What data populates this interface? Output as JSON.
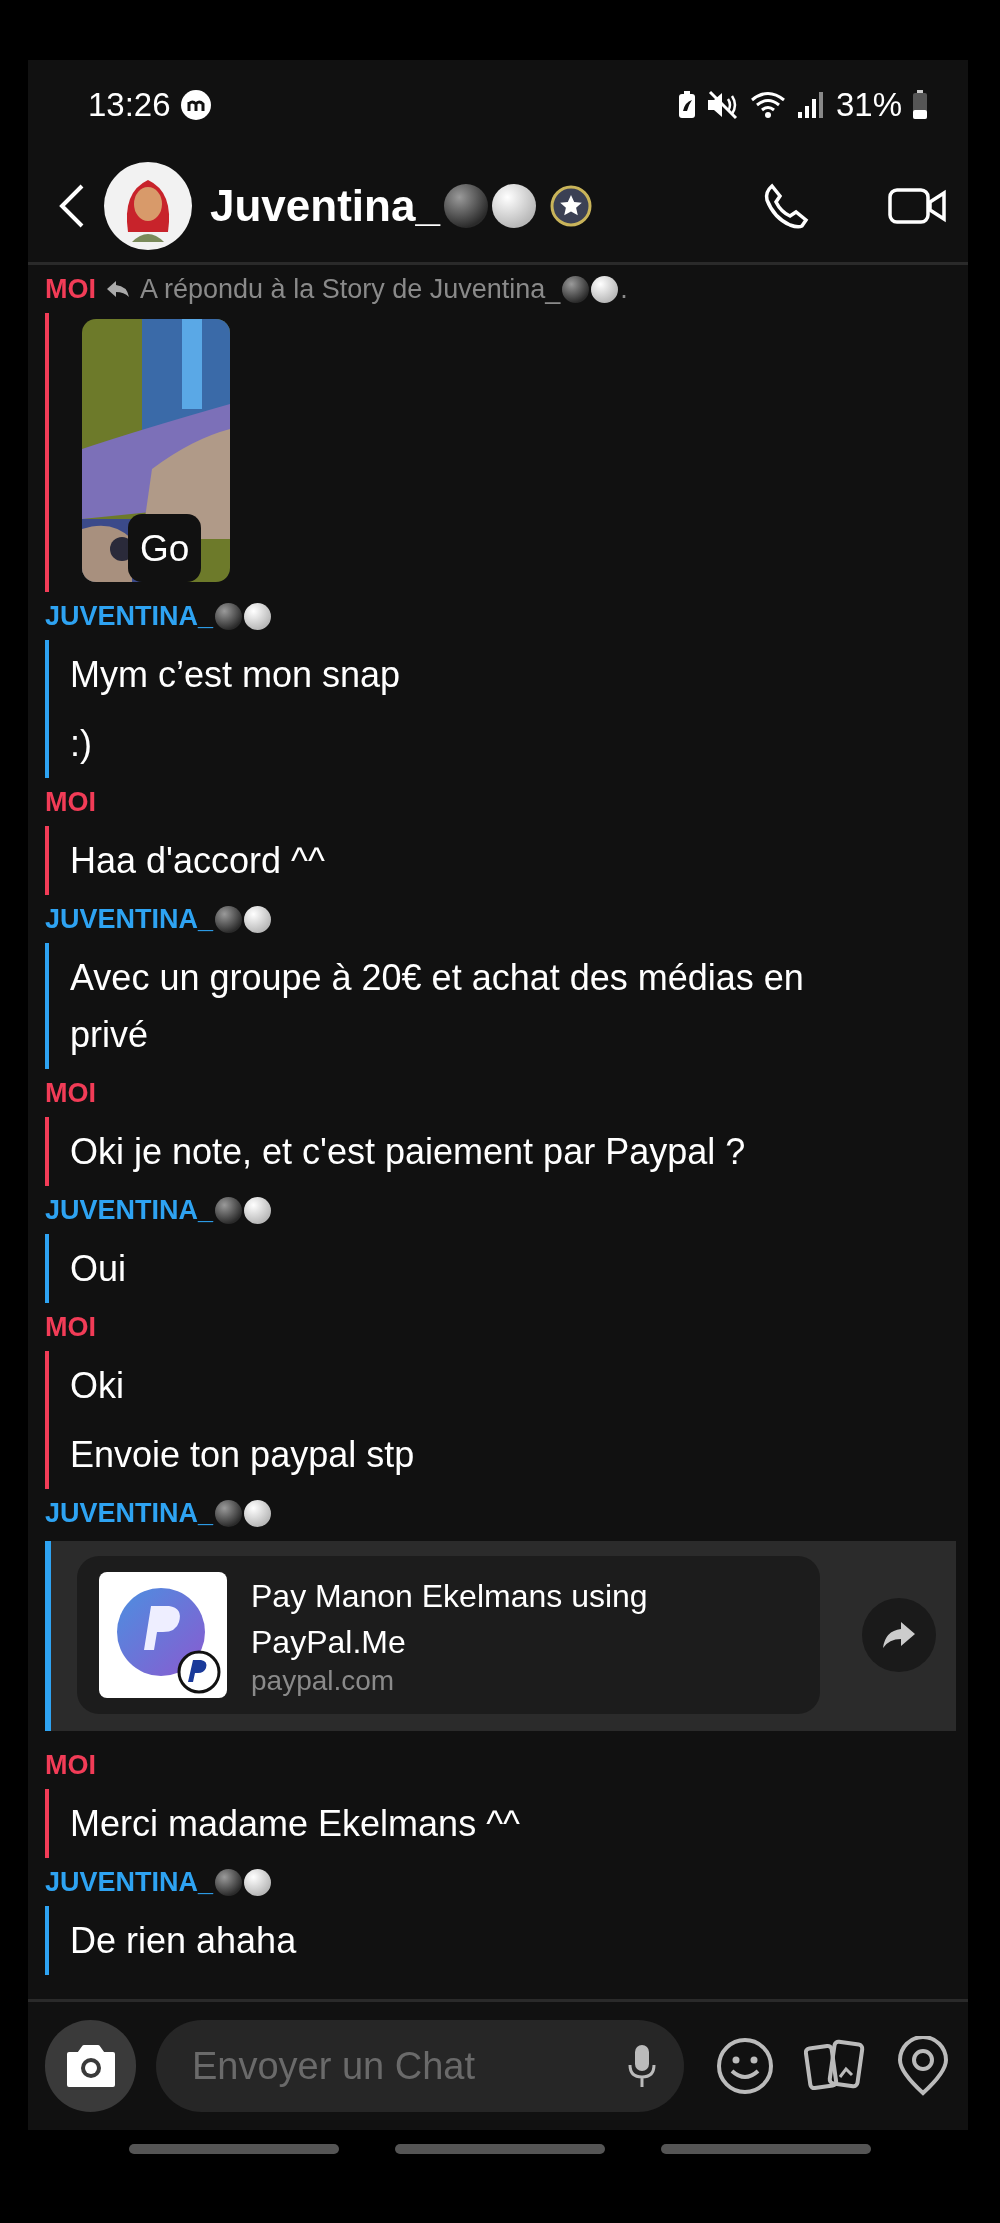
{
  "status_bar": {
    "time": "13:26",
    "battery": "31%"
  },
  "header": {
    "name": "Juventina_"
  },
  "groups": [
    {
      "sender": "MOI",
      "kind": "me",
      "reply_note": "A répondu à la Story de Juventina_",
      "reply_note_end": ".",
      "messages": [
        {
          "kind": "story",
          "text": "Go"
        }
      ]
    },
    {
      "sender": "JUVENTINA_",
      "kind": "them",
      "messages": [
        {
          "kind": "text",
          "text": "Mym c’est mon snap"
        },
        {
          "kind": "text",
          "text": ":)"
        }
      ]
    },
    {
      "sender": "MOI",
      "kind": "me",
      "messages": [
        {
          "kind": "text",
          "text": "Haa d'accord ^^"
        }
      ]
    },
    {
      "sender": "JUVENTINA_",
      "kind": "them",
      "messages": [
        {
          "kind": "text",
          "text": "Avec un groupe à 20€ et achat des médias en privé"
        }
      ]
    },
    {
      "sender": "MOI",
      "kind": "me",
      "messages": [
        {
          "kind": "text",
          "text": "Oki je note, et c'est paiement par Paypal ?"
        }
      ]
    },
    {
      "sender": "JUVENTINA_",
      "kind": "them",
      "messages": [
        {
          "kind": "text",
          "text": "Oui"
        }
      ]
    },
    {
      "sender": "MOI",
      "kind": "me",
      "messages": [
        {
          "kind": "text",
          "text": "Oki"
        },
        {
          "kind": "text",
          "text": "Envoie ton paypal stp"
        }
      ]
    },
    {
      "sender": "JUVENTINA_",
      "kind": "them",
      "messages": [
        {
          "kind": "link",
          "title": "Pay Manon Ekelmans using PayPal.Me",
          "domain": "paypal.com"
        }
      ]
    },
    {
      "sender": "MOI",
      "kind": "me",
      "messages": [
        {
          "kind": "text",
          "text": "Merci madame Ekelmans ^^"
        }
      ]
    },
    {
      "sender": "JUVENTINA_",
      "kind": "them",
      "messages": [
        {
          "kind": "text",
          "text": "De rien ahaha"
        }
      ]
    }
  ],
  "composer": {
    "placeholder": "Envoyer un Chat"
  }
}
